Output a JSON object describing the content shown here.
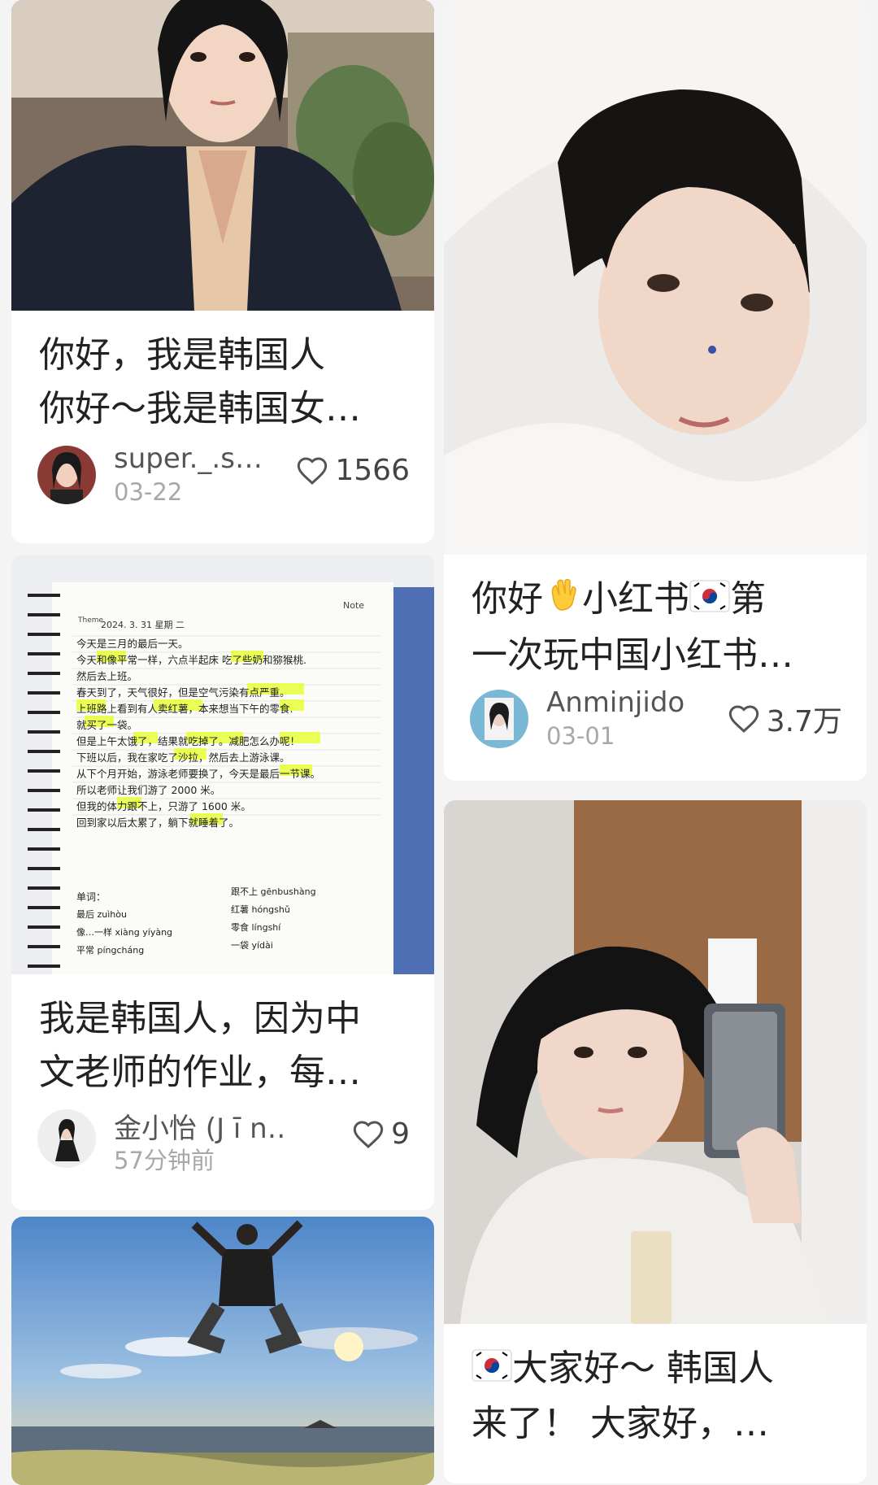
{
  "feed": {
    "cards": [
      {
        "title_line1": "你好，我是韩国人",
        "title_line2": "你好～我是韩国女…",
        "author": "super._.s…",
        "date": "03-22",
        "likes": "1566"
      },
      {
        "title_text1": "小红书",
        "title_text2": "第",
        "title_line2": "一次玩中国小红书…",
        "title_prefix": "你好",
        "author": "Anminjido",
        "date": "03-01",
        "likes": "3.7万"
      },
      {
        "title_line1": "我是韩国人，因为中",
        "title_line2": "文老师的作业，每…",
        "author": "金小怡 (J ī n…",
        "date": "57分钟前",
        "likes": "9"
      },
      {
        "title_line1": "大家好～ 韩国人",
        "title_line2": "来了！ 大家好，…"
      }
    ],
    "notebook": {
      "brand": "Note",
      "theme_label": "Theme",
      "date_line": "2024. 3. 31 星期 二",
      "lines": [
        "今天是三月的最后一天。",
        "今天和像平常一样，六点半起床 吃了些奶和猕猴桃.",
        "然后去上班。",
        "春天到了，天气很好，但是空气污染有点严重。",
        "上班路上看到有人卖红薯，本来想当下午的零食.",
        "就买了一袋。",
        "但是上午太饿了，结果就吃掉了。减肥怎么办呢！",
        "下班以后，我在家吃了沙拉，然后去上游泳课。",
        "从下个月开始，游泳老师要换了，今天是最后一节课。",
        "所以老师让我们游了 2000 米。",
        "但我的体力跟不上，只游了 1600 米。",
        "回到家以后太累了，躺下就睡着了。"
      ],
      "vocab_title": "单词：",
      "vocab_left": [
        "最后 zuìhòu",
        "像…一样 xiàng yíyàng",
        "平常 píngcháng"
      ],
      "vocab_right": [
        "跟不上 gēnbushàng",
        "红薯 hóngshǔ",
        "零食 língshí",
        "一袋 yídài"
      ]
    }
  },
  "colors": {
    "background": "#f4f4f4",
    "card": "#ffffff",
    "title_text": "#222222",
    "meta_text": "#555555",
    "date_text": "#a8a8a8",
    "highlight": "#e8ff3a"
  }
}
